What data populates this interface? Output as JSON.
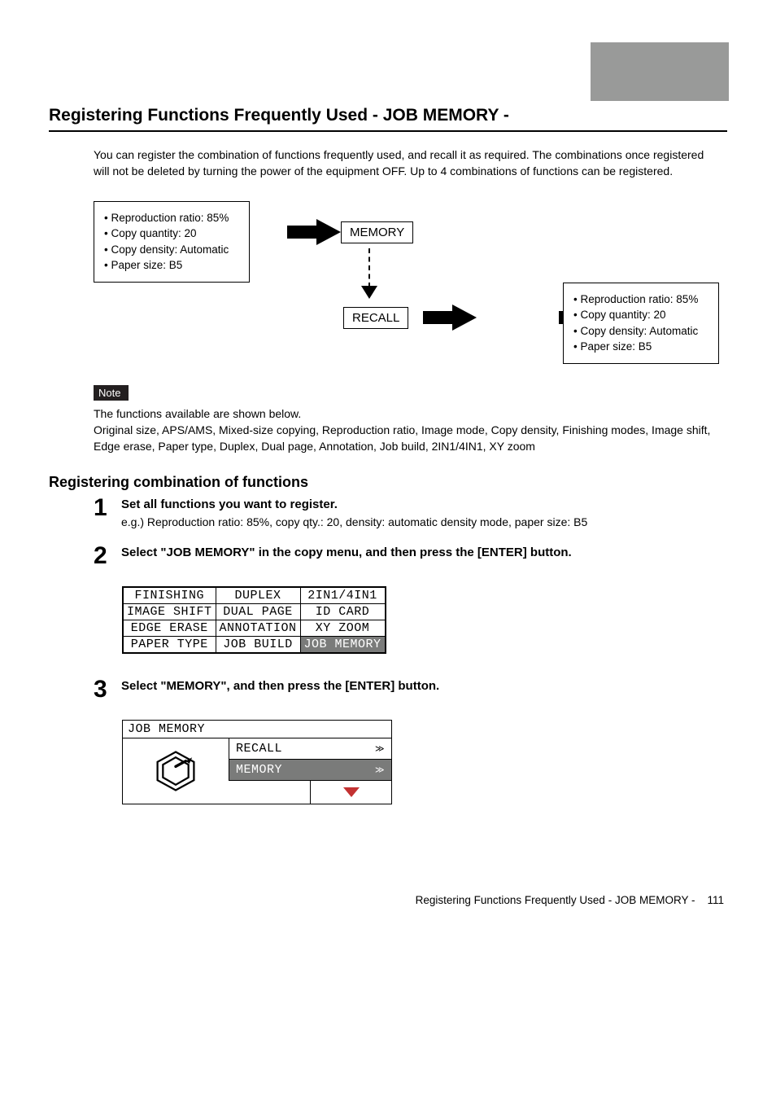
{
  "title": "Registering Functions Frequently Used - JOB MEMORY -",
  "intro": "You can register the combination of functions frequently used, and recall it as required. The combinations once registered will not be deleted by turning the power of the equipment OFF. Up to 4 combinations of functions can be registered.",
  "settings": {
    "item1": "Reproduction ratio: 85%",
    "item2": "Copy quantity: 20",
    "item3": "Copy density: Automatic",
    "item4": "Paper size: B5"
  },
  "diagram_labels": {
    "memory": "MEMORY",
    "recall": "RECALL"
  },
  "note": {
    "badge": "Note",
    "line1": "The functions available are shown below.",
    "line2": "Original size, APS/AMS, Mixed-size copying, Reproduction ratio, Image mode, Copy density, Finishing modes, Image shift, Edge erase, Paper type, Duplex, Dual page, Annotation, Job build, 2IN1/4IN1, XY zoom"
  },
  "subheading": "Registering combination of functions",
  "steps": {
    "s1": {
      "num": "1",
      "title": "Set all functions you want to register.",
      "body": "e.g.) Reproduction ratio: 85%, copy qty.: 20, density: automatic density mode, paper size: B5"
    },
    "s2": {
      "num": "2",
      "title": "Select \"JOB MEMORY\" in the copy menu, and then press the [ENTER] button."
    },
    "s3": {
      "num": "3",
      "title": "Select \"MEMORY\", and then press the [ENTER] button."
    }
  },
  "lcd1": {
    "r0c0": "FINISHING",
    "r0c1": "  DUPLEX  ",
    "r0c2": "2IN1/4IN1",
    "r1c0": "IMAGE SHIFT",
    "r1c1": "DUAL PAGE",
    "r1c2": " ID CARD ",
    "r2c0": "EDGE ERASE",
    "r2c1": "ANNOTATION",
    "r2c2": " XY ZOOM ",
    "r3c0": "PAPER TYPE",
    "r3c1": "JOB BUILD",
    "r3c2": "JOB MEMORY"
  },
  "lcd2": {
    "header": "JOB MEMORY",
    "opt1": "RECALL",
    "opt2": "MEMORY"
  },
  "footer": {
    "text": "Registering Functions Frequently Used - JOB MEMORY -",
    "page": "111"
  }
}
